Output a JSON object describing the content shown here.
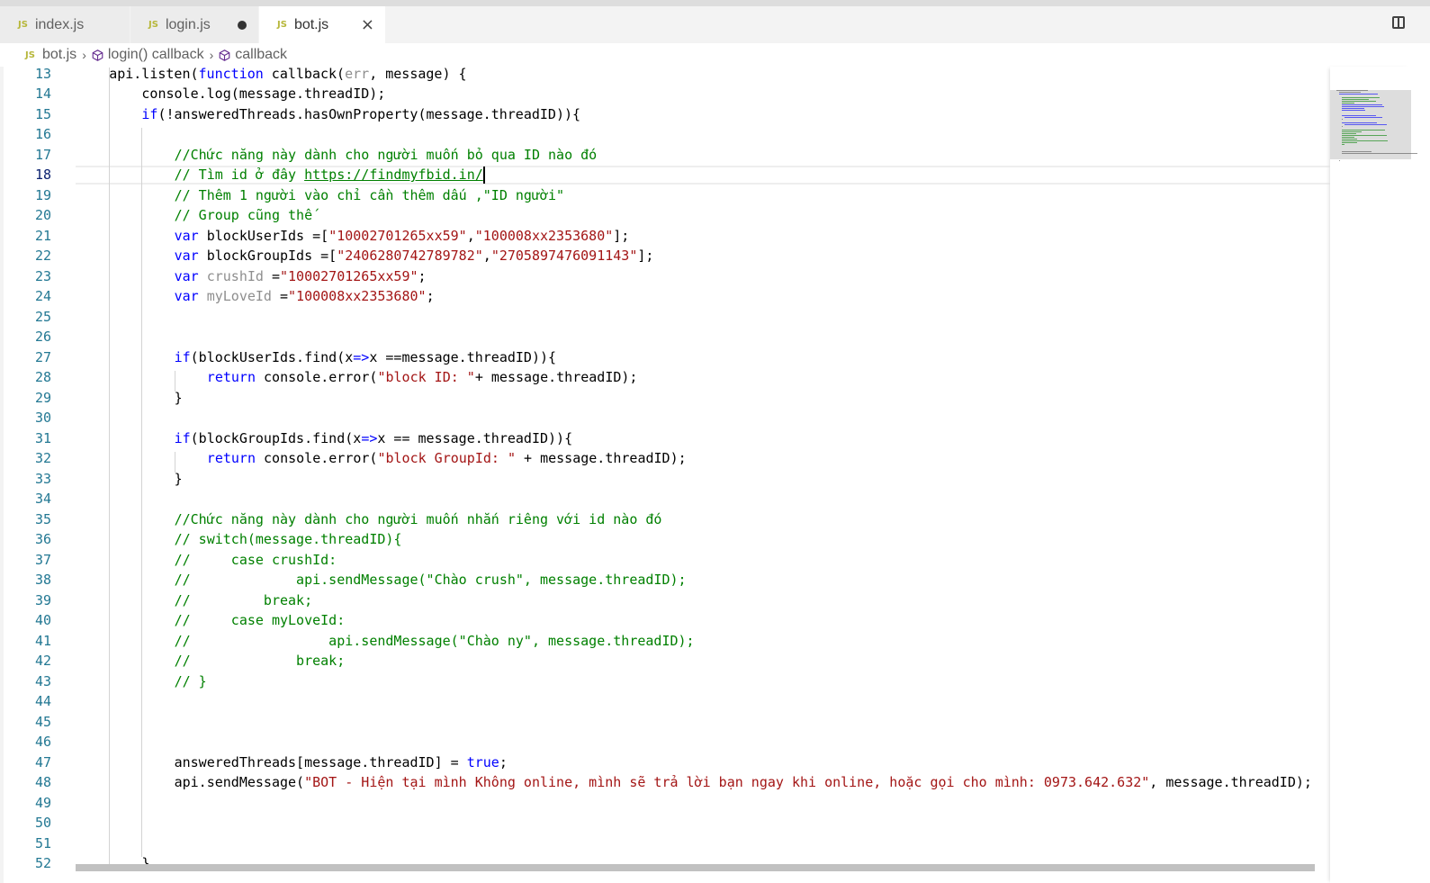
{
  "tabs": [
    {
      "label": "index.js",
      "icon": "js-file-icon",
      "active": false,
      "dirty": false
    },
    {
      "label": "login.js",
      "icon": "js-file-icon",
      "active": false,
      "dirty": true
    },
    {
      "label": "bot.js",
      "icon": "js-file-icon",
      "active": true,
      "dirty": false
    }
  ],
  "tab_icon_text": "JS",
  "close_glyph": "×",
  "breadcrumb": {
    "file": "bot.js",
    "separator": "›",
    "items": [
      {
        "label": "login() callback",
        "icon": "symbol-method-icon"
      },
      {
        "label": "callback",
        "icon": "symbol-method-icon"
      }
    ]
  },
  "editor": {
    "current_line": 18,
    "lines": [
      {
        "n": "13",
        "indent": 1,
        "tokens": [
          [
            "",
            "api.listen("
          ],
          [
            "kw",
            "function"
          ],
          [
            "",
            " callback("
          ],
          [
            "dim",
            "err"
          ],
          [
            "",
            ", message) {"
          ]
        ]
      },
      {
        "n": "14",
        "indent": 2,
        "tokens": [
          [
            "",
            "console.log(message.threadID);"
          ]
        ]
      },
      {
        "n": "15",
        "indent": 2,
        "tokens": [
          [
            "kw",
            "if"
          ],
          [
            "",
            "(!answeredThreads.hasOwnProperty(message.threadID)){"
          ]
        ]
      },
      {
        "n": "16",
        "indent": 0,
        "tokens": []
      },
      {
        "n": "17",
        "indent": 3,
        "tokens": [
          [
            "cm",
            "//Chức năng này dành cho người muốn bỏ qua ID nào đó"
          ]
        ]
      },
      {
        "n": "18",
        "indent": 3,
        "tokens": [
          [
            "cm",
            "// Tìm id ở đây "
          ],
          [
            "link",
            "https://findmyfbid.in/"
          ],
          [
            "cursor",
            ""
          ]
        ]
      },
      {
        "n": "19",
        "indent": 3,
        "tokens": [
          [
            "cm",
            "// Thêm 1 người vào chỉ cần thêm dấu ,\"ID người\""
          ]
        ]
      },
      {
        "n": "20",
        "indent": 3,
        "tokens": [
          [
            "cm",
            "// Group cũng thế"
          ]
        ]
      },
      {
        "n": "21",
        "indent": 3,
        "tokens": [
          [
            "kw",
            "var"
          ],
          [
            "",
            " blockUserIds =["
          ],
          [
            "str",
            "\"10002701265xx59\""
          ],
          [
            "",
            ","
          ],
          [
            "str",
            "\"100008xx2353680\""
          ],
          [
            "",
            "];"
          ]
        ]
      },
      {
        "n": "22",
        "indent": 3,
        "tokens": [
          [
            "kw",
            "var"
          ],
          [
            "",
            " blockGroupIds =["
          ],
          [
            "str",
            "\"2406280742789782\""
          ],
          [
            "",
            ","
          ],
          [
            "str",
            "\"2705897476091143\""
          ],
          [
            "",
            "];"
          ]
        ]
      },
      {
        "n": "23",
        "indent": 3,
        "tokens": [
          [
            "kw",
            "var"
          ],
          [
            "dim",
            " crushId"
          ],
          [
            "",
            " ="
          ],
          [
            "str",
            "\"10002701265xx59\""
          ],
          [
            "",
            ";"
          ]
        ]
      },
      {
        "n": "24",
        "indent": 3,
        "tokens": [
          [
            "kw",
            "var"
          ],
          [
            "dim",
            " myLoveId"
          ],
          [
            "",
            " ="
          ],
          [
            "str",
            "\"100008xx2353680\""
          ],
          [
            "",
            ";"
          ]
        ]
      },
      {
        "n": "25",
        "indent": 0,
        "tokens": []
      },
      {
        "n": "26",
        "indent": 0,
        "tokens": []
      },
      {
        "n": "27",
        "indent": 3,
        "tokens": [
          [
            "kw",
            "if"
          ],
          [
            "",
            "(blockUserIds.find(x"
          ],
          [
            "kw",
            "=>"
          ],
          [
            "",
            "x ==message.threadID)){"
          ]
        ]
      },
      {
        "n": "28",
        "indent": 4,
        "tokens": [
          [
            "kw",
            "return"
          ],
          [
            "",
            " console.error("
          ],
          [
            "str",
            "\"block ID: \""
          ],
          [
            "",
            "+ message.threadID);"
          ]
        ]
      },
      {
        "n": "29",
        "indent": 3,
        "tokens": [
          [
            "",
            "}"
          ]
        ]
      },
      {
        "n": "30",
        "indent": 0,
        "tokens": []
      },
      {
        "n": "31",
        "indent": 3,
        "tokens": [
          [
            "kw",
            "if"
          ],
          [
            "",
            "(blockGroupIds.find(x"
          ],
          [
            "kw",
            "=>"
          ],
          [
            "",
            "x == message.threadID)){"
          ]
        ]
      },
      {
        "n": "32",
        "indent": 4,
        "tokens": [
          [
            "kw",
            "return"
          ],
          [
            "",
            " console.error("
          ],
          [
            "str",
            "\"block GroupId: \""
          ],
          [
            "",
            " + message.threadID);"
          ]
        ]
      },
      {
        "n": "33",
        "indent": 3,
        "tokens": [
          [
            "",
            "}"
          ]
        ]
      },
      {
        "n": "34",
        "indent": 0,
        "tokens": []
      },
      {
        "n": "35",
        "indent": 3,
        "tokens": [
          [
            "cm",
            "//Chức năng này dành cho người muốn nhắn riêng với id nào đó"
          ]
        ]
      },
      {
        "n": "36",
        "indent": 3,
        "tokens": [
          [
            "cm",
            "// switch(message.threadID){"
          ]
        ]
      },
      {
        "n": "37",
        "indent": 3,
        "tokens": [
          [
            "cm",
            "//     case crushId:"
          ]
        ]
      },
      {
        "n": "38",
        "indent": 3,
        "tokens": [
          [
            "cm",
            "//             api.sendMessage(\"Chào crush\", message.threadID);"
          ]
        ]
      },
      {
        "n": "39",
        "indent": 3,
        "tokens": [
          [
            "cm",
            "//         break;"
          ]
        ]
      },
      {
        "n": "40",
        "indent": 3,
        "tokens": [
          [
            "cm",
            "//     case myLoveId:"
          ]
        ]
      },
      {
        "n": "41",
        "indent": 3,
        "tokens": [
          [
            "cm",
            "//                 api.sendMessage(\"Chào ny\", message.threadID);"
          ]
        ]
      },
      {
        "n": "42",
        "indent": 3,
        "tokens": [
          [
            "cm",
            "//             break;"
          ]
        ]
      },
      {
        "n": "43",
        "indent": 3,
        "tokens": [
          [
            "cm",
            "// }"
          ]
        ]
      },
      {
        "n": "44",
        "indent": 0,
        "tokens": []
      },
      {
        "n": "45",
        "indent": 0,
        "tokens": []
      },
      {
        "n": "46",
        "indent": 0,
        "tokens": []
      },
      {
        "n": "47",
        "indent": 3,
        "tokens": [
          [
            "",
            "answeredThreads[message.threadID] = "
          ],
          [
            "kw",
            "true"
          ],
          [
            "",
            ";"
          ]
        ]
      },
      {
        "n": "48",
        "indent": 3,
        "tokens": [
          [
            "",
            "api.sendMessage("
          ],
          [
            "str",
            "\"BOT - Hiện tại mình Không online, mình sẽ trả lời bạn ngay khi online, hoặc gọi cho mình: 0973.642.632\""
          ],
          [
            "",
            ", message.threadID);"
          ]
        ]
      },
      {
        "n": "49",
        "indent": 0,
        "tokens": []
      },
      {
        "n": "50",
        "indent": 0,
        "tokens": []
      },
      {
        "n": "51",
        "indent": 0,
        "tokens": []
      },
      {
        "n": "52",
        "indent": 2,
        "tokens": [
          [
            "",
            "}"
          ]
        ]
      }
    ]
  },
  "colors": {
    "keyword": "#0000ff",
    "string": "#a31515",
    "comment": "#008000",
    "line_number": "#237893",
    "js_icon": "#b7b73b"
  }
}
